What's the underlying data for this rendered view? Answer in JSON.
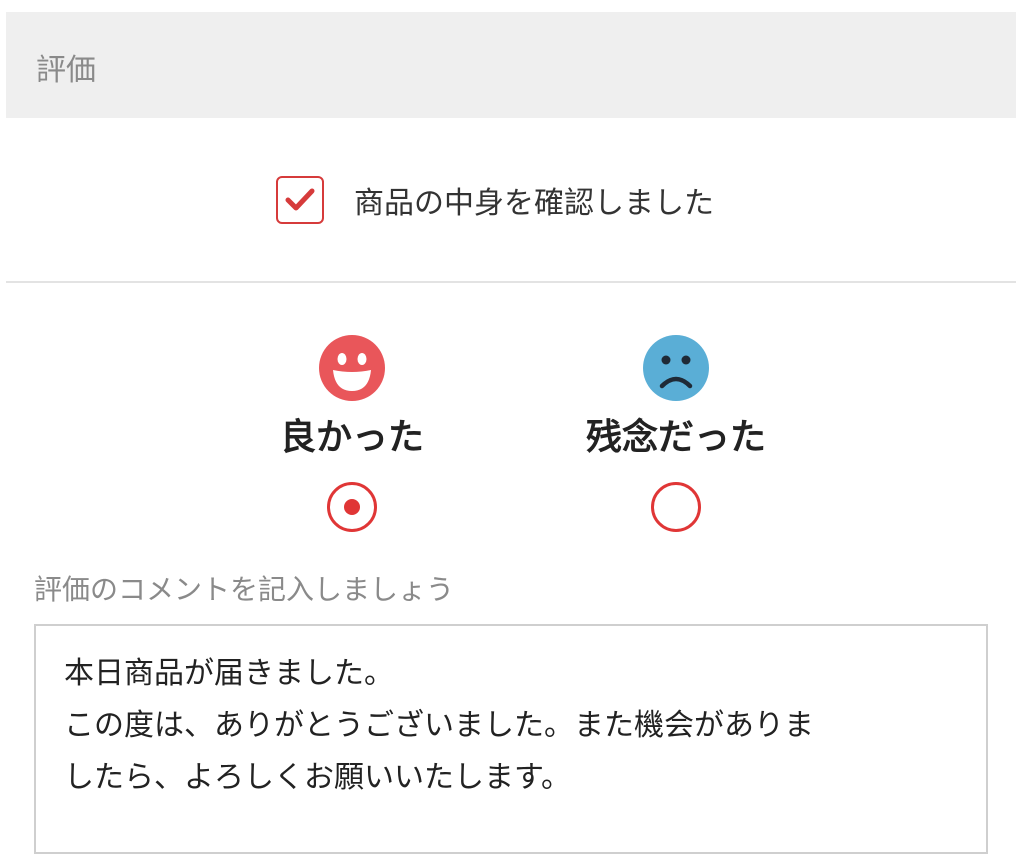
{
  "section": {
    "title": "評価"
  },
  "confirmation": {
    "label": "商品の中身を確認しました",
    "checked": true,
    "icon": "checkmark-icon"
  },
  "ratings": [
    {
      "id": "good",
      "label": "良かった",
      "icon": "smiling-face-icon",
      "color": "#e9565a",
      "selected": true
    },
    {
      "id": "bad",
      "label": "残念だった",
      "icon": "sad-face-icon",
      "color": "#5aaed6",
      "selected": false
    }
  ],
  "comment": {
    "prompt": "評価のコメントを記入しましょう",
    "value": "本日商品が届きました。\nこの度は、ありがとうございました。また機会がありま\nしたら、よろしくお願いいたします。"
  },
  "colors": {
    "accent": "#e03636",
    "header_bg": "#efefef"
  }
}
